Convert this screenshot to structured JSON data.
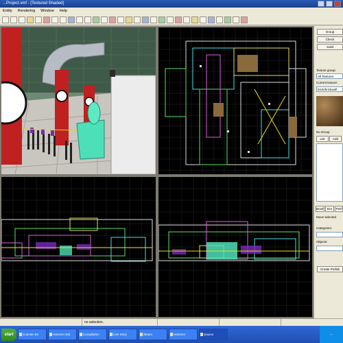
{
  "window": {
    "title": "...Project.vmf - [Textured Shaded]"
  },
  "menu": {
    "items": [
      "Entity",
      "Rendering",
      "Window",
      "Help"
    ]
  },
  "sidebar": {
    "buttons": [
      "Group",
      "Check",
      "Solid"
    ],
    "texture_group_label": "Texture group:",
    "texture_group_value": "All Textures",
    "current_texture_label": "Current texture:",
    "current_texture_value": "brick/brickwall",
    "no_group_label": "No Group",
    "tab_list": "List",
    "tab_add": "Add",
    "bottom_tabs": [
      "Brush",
      "Ent",
      "Pref"
    ],
    "move_selected_label": "Move selected",
    "categories_label": "Categories:",
    "objects_label": "Objects:",
    "create_prefab_label": "Create Prefab"
  },
  "status": {
    "selection": "no selection."
  },
  "taskbar": {
    "start_label": "start",
    "items": [
      "Counter-Str",
      "Hammer Edi",
      "Compilation",
      "Live Story",
      "Steam",
      "Hammer",
      "Source"
    ],
    "tray_text": "..."
  },
  "colors": {
    "title": "#2a5db8",
    "viewport_bg": "#000000",
    "taskbar": "#3168d5"
  }
}
